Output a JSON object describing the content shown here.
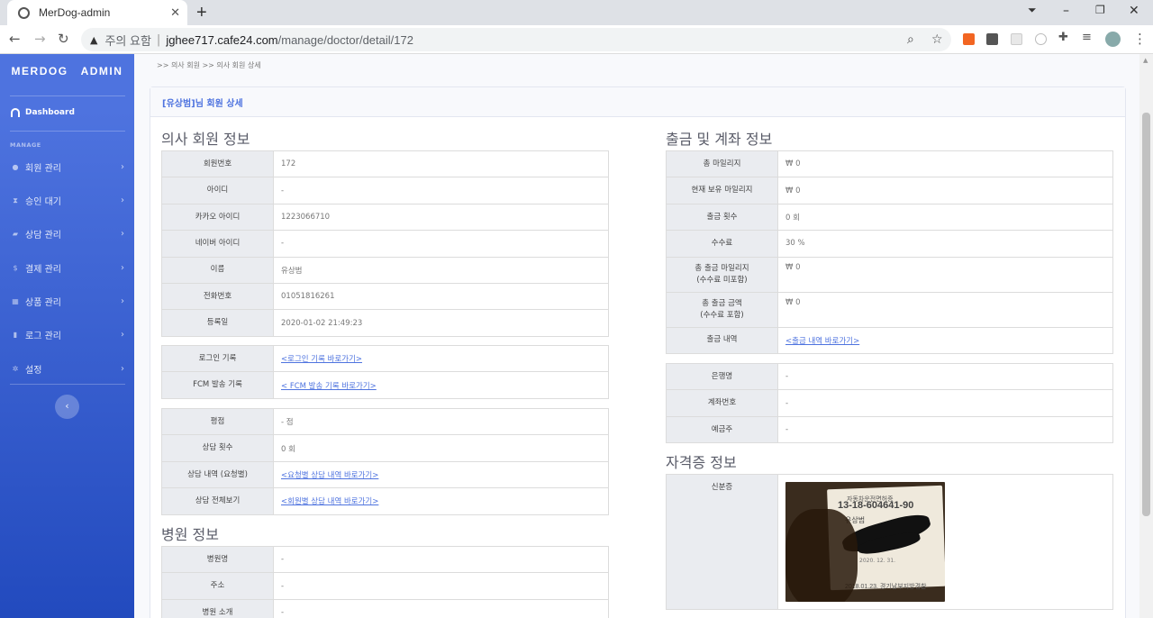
{
  "browser": {
    "tab_title": "MerDog-admin",
    "security": "주의 요함",
    "url_host": "jghee717.cafe24.com",
    "url_path": "/manage/doctor/detail/172"
  },
  "sidebar": {
    "brand": "MERDOG   ADMIN",
    "dashboard": "Dashboard",
    "heading": "MANAGE",
    "items": [
      {
        "label": "회원 관리",
        "icon": "user-icon"
      },
      {
        "label": "승인 대기",
        "icon": "hourglass-icon"
      },
      {
        "label": "상담 관리",
        "icon": "comments-icon"
      },
      {
        "label": "결제 관리",
        "icon": "dollar-icon"
      },
      {
        "label": "상품 관리",
        "icon": "cubes-icon"
      },
      {
        "label": "로그 관리",
        "icon": "clipboard-icon"
      },
      {
        "label": "설정",
        "icon": "gear-icon"
      }
    ]
  },
  "breadcrumb": ">> 의사 회원 >> 의사 회원 상세",
  "card_title": "[유상범]님 회원 상세",
  "left": {
    "title": "의사 회원 정보",
    "table1": [
      {
        "k": "회원번호",
        "v": "172"
      },
      {
        "k": "아이디",
        "v": "-"
      },
      {
        "k": "카카오 아이디",
        "v": "1223066710"
      },
      {
        "k": "네이버 아이디",
        "v": "-"
      },
      {
        "k": "이름",
        "v": "유상범"
      },
      {
        "k": "전화번호",
        "v": "01051816261"
      },
      {
        "k": "등록일",
        "v": "2020-01-02 21:49:23"
      }
    ],
    "table2": [
      {
        "k": "로그인 기록",
        "link": "<로그인 기록 바로가기>"
      },
      {
        "k": "FCM 발송 기록",
        "link": "< FCM 발송 기록 바로가기>"
      }
    ],
    "table3": [
      {
        "k": "평점",
        "v": "- 점"
      },
      {
        "k": "상담 횟수",
        "v": "0 회"
      },
      {
        "k": "상담 내역 (요청별)",
        "link": "<요청별 상담 내역 바로가기>"
      },
      {
        "k": "상담 전체보기",
        "link": "<회원별 상담 내역 바로가기>"
      }
    ],
    "hospital_title": "병원 정보",
    "hospital": [
      {
        "k": "병원명",
        "v": "-"
      },
      {
        "k": "주소",
        "v": "-"
      },
      {
        "k": "병원 소개",
        "v": "-"
      }
    ]
  },
  "right": {
    "title": "출금 및 계좌 정보",
    "table1": [
      {
        "k": "총 마일리지",
        "v": "₩ 0"
      },
      {
        "k": "현재 보유 마일리지",
        "v": "₩ 0"
      },
      {
        "k": "출금 횟수",
        "v": "0 회"
      },
      {
        "k": "수수료",
        "v": "30 %"
      },
      {
        "k1": "총 출금 마일리지",
        "k2": "(수수료 미포함)",
        "v": "₩ 0"
      },
      {
        "k1": "총 출금 금액",
        "k2": "(수수료 포함)",
        "v": "₩ 0"
      },
      {
        "k": "출금 내역",
        "link": "<출금 내역 바로가기>"
      }
    ],
    "table2": [
      {
        "k": "은행명",
        "v": "-"
      },
      {
        "k": "계좌번호",
        "v": "-"
      },
      {
        "k": "예금주",
        "v": "-"
      }
    ],
    "cert_title": "자격증 정보",
    "cert": {
      "k": "신분증",
      "photo_texts": {
        "t1": "자동차운전면허증",
        "t2": "13-18-604641-90",
        "t3": "유상범",
        "t5": "2020. 12. 31.",
        "foot": "2018.01.23. 경기남부지방경찰"
      }
    }
  }
}
